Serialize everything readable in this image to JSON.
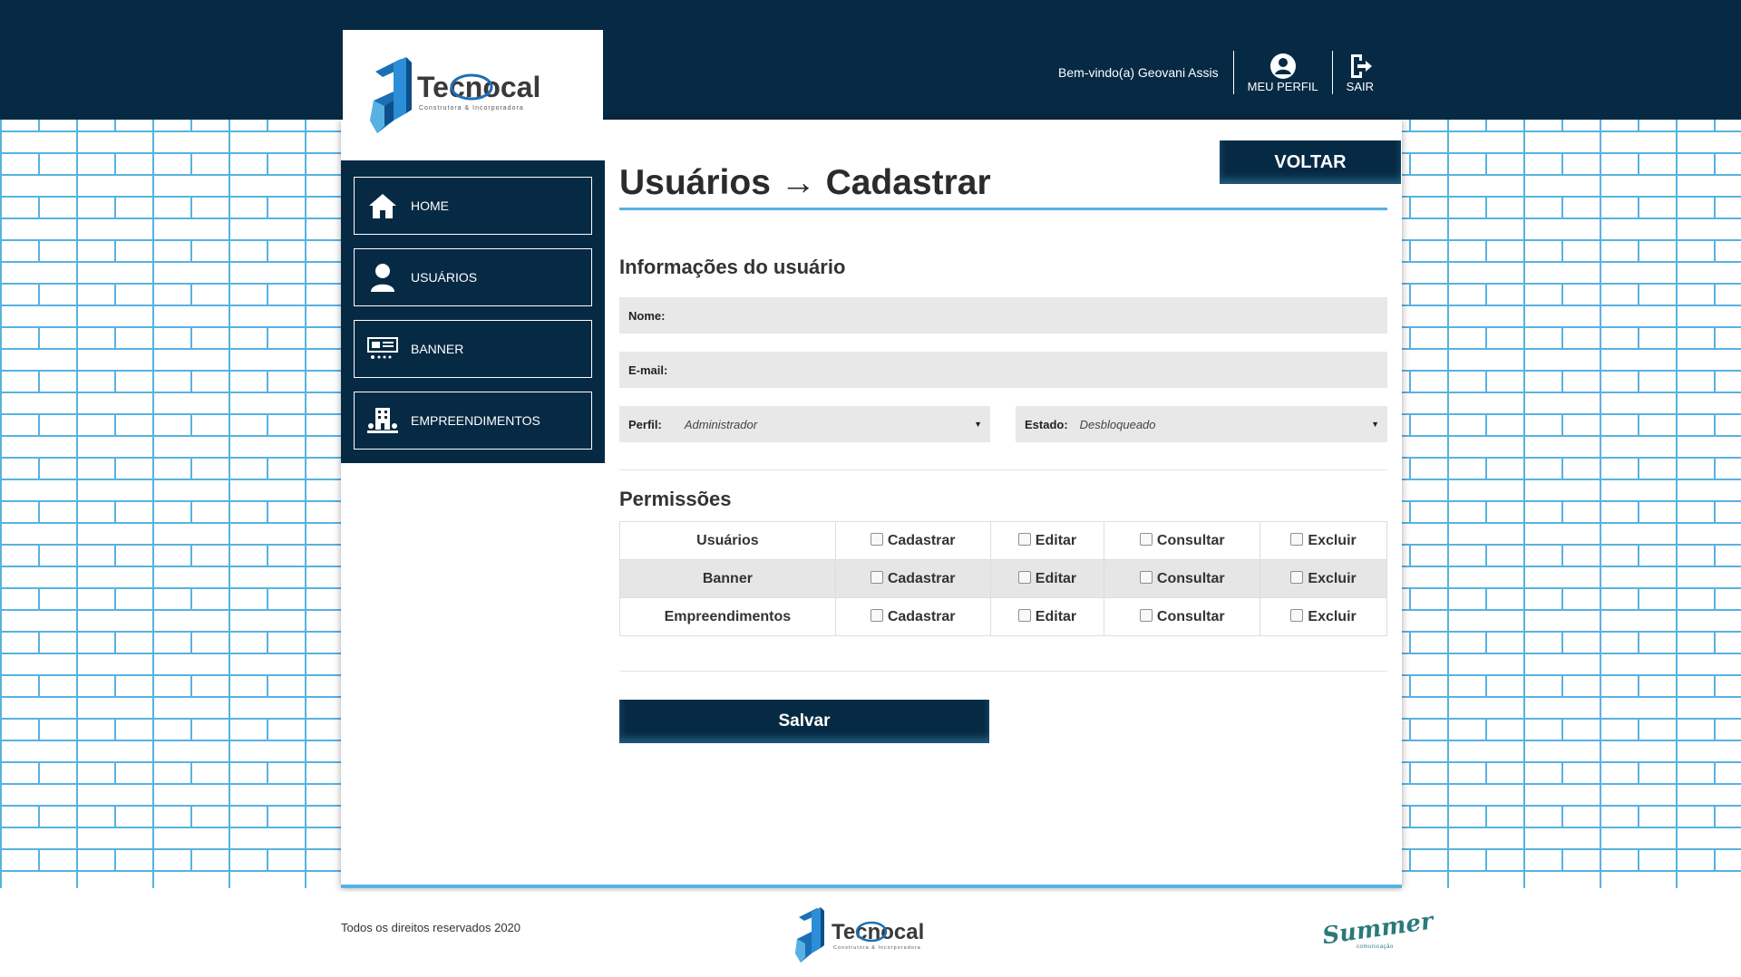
{
  "brand": {
    "name": "Tecnocal",
    "tagline": "Construtora & Incorporadora"
  },
  "header": {
    "welcome": "Bem-vindo(a) Geovani Assis",
    "profile_label": "MEU PERFIL",
    "logout_label": "SAIR"
  },
  "sidebar": {
    "items": [
      {
        "label": "HOME",
        "icon": "home-icon"
      },
      {
        "label": "USUÁRIOS",
        "icon": "user-icon"
      },
      {
        "label": "BANNER",
        "icon": "banner-icon"
      },
      {
        "label": "EMPREENDIMENTOS",
        "icon": "building-icon"
      }
    ]
  },
  "page": {
    "title": "Usuários → Cadastrar",
    "back_label": "VOLTAR"
  },
  "form": {
    "section_title": "Informações do usuário",
    "name_label": "Nome:",
    "name_value": "",
    "email_label": "E-mail:",
    "email_value": "",
    "profile_label": "Perfil:",
    "profile_value": "Administrador",
    "state_label": "Estado:",
    "state_value": "Desbloqueado"
  },
  "permissions": {
    "section_title": "Permissões",
    "actions": [
      "Cadastrar",
      "Editar",
      "Consultar",
      "Excluir"
    ],
    "rows": [
      {
        "module": "Usuários",
        "checked": [
          false,
          false,
          false,
          false
        ]
      },
      {
        "module": "Banner",
        "checked": [
          false,
          false,
          false,
          false
        ]
      },
      {
        "module": "Empreendimentos",
        "checked": [
          false,
          false,
          false,
          false
        ]
      }
    ]
  },
  "save_label": "Salvar",
  "footer": {
    "copyright": "Todos os direitos reservados 2020",
    "agency": "Summer",
    "agency_sub": "comunicação"
  },
  "colors": {
    "navy": "#062a44",
    "accent_blue": "#57b2e3",
    "field_gray": "#e8e8e8"
  }
}
